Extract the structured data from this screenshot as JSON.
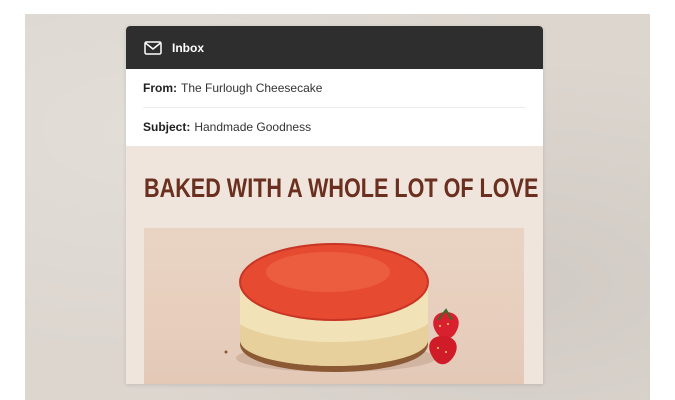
{
  "inbox": {
    "label": "Inbox",
    "icon": "envelope-icon"
  },
  "email": {
    "from_label": "From:",
    "from_value": "The Furlough Cheesecake",
    "subject_label": "Subject:",
    "subject_value": "Handmade Goodness",
    "headline": "BAKED WITH A WHOLE LOT OF LOVE"
  },
  "colors": {
    "header_bar": "#2e2e2e",
    "headline": "#6a2f1e",
    "email_background": "#efe5dc"
  }
}
